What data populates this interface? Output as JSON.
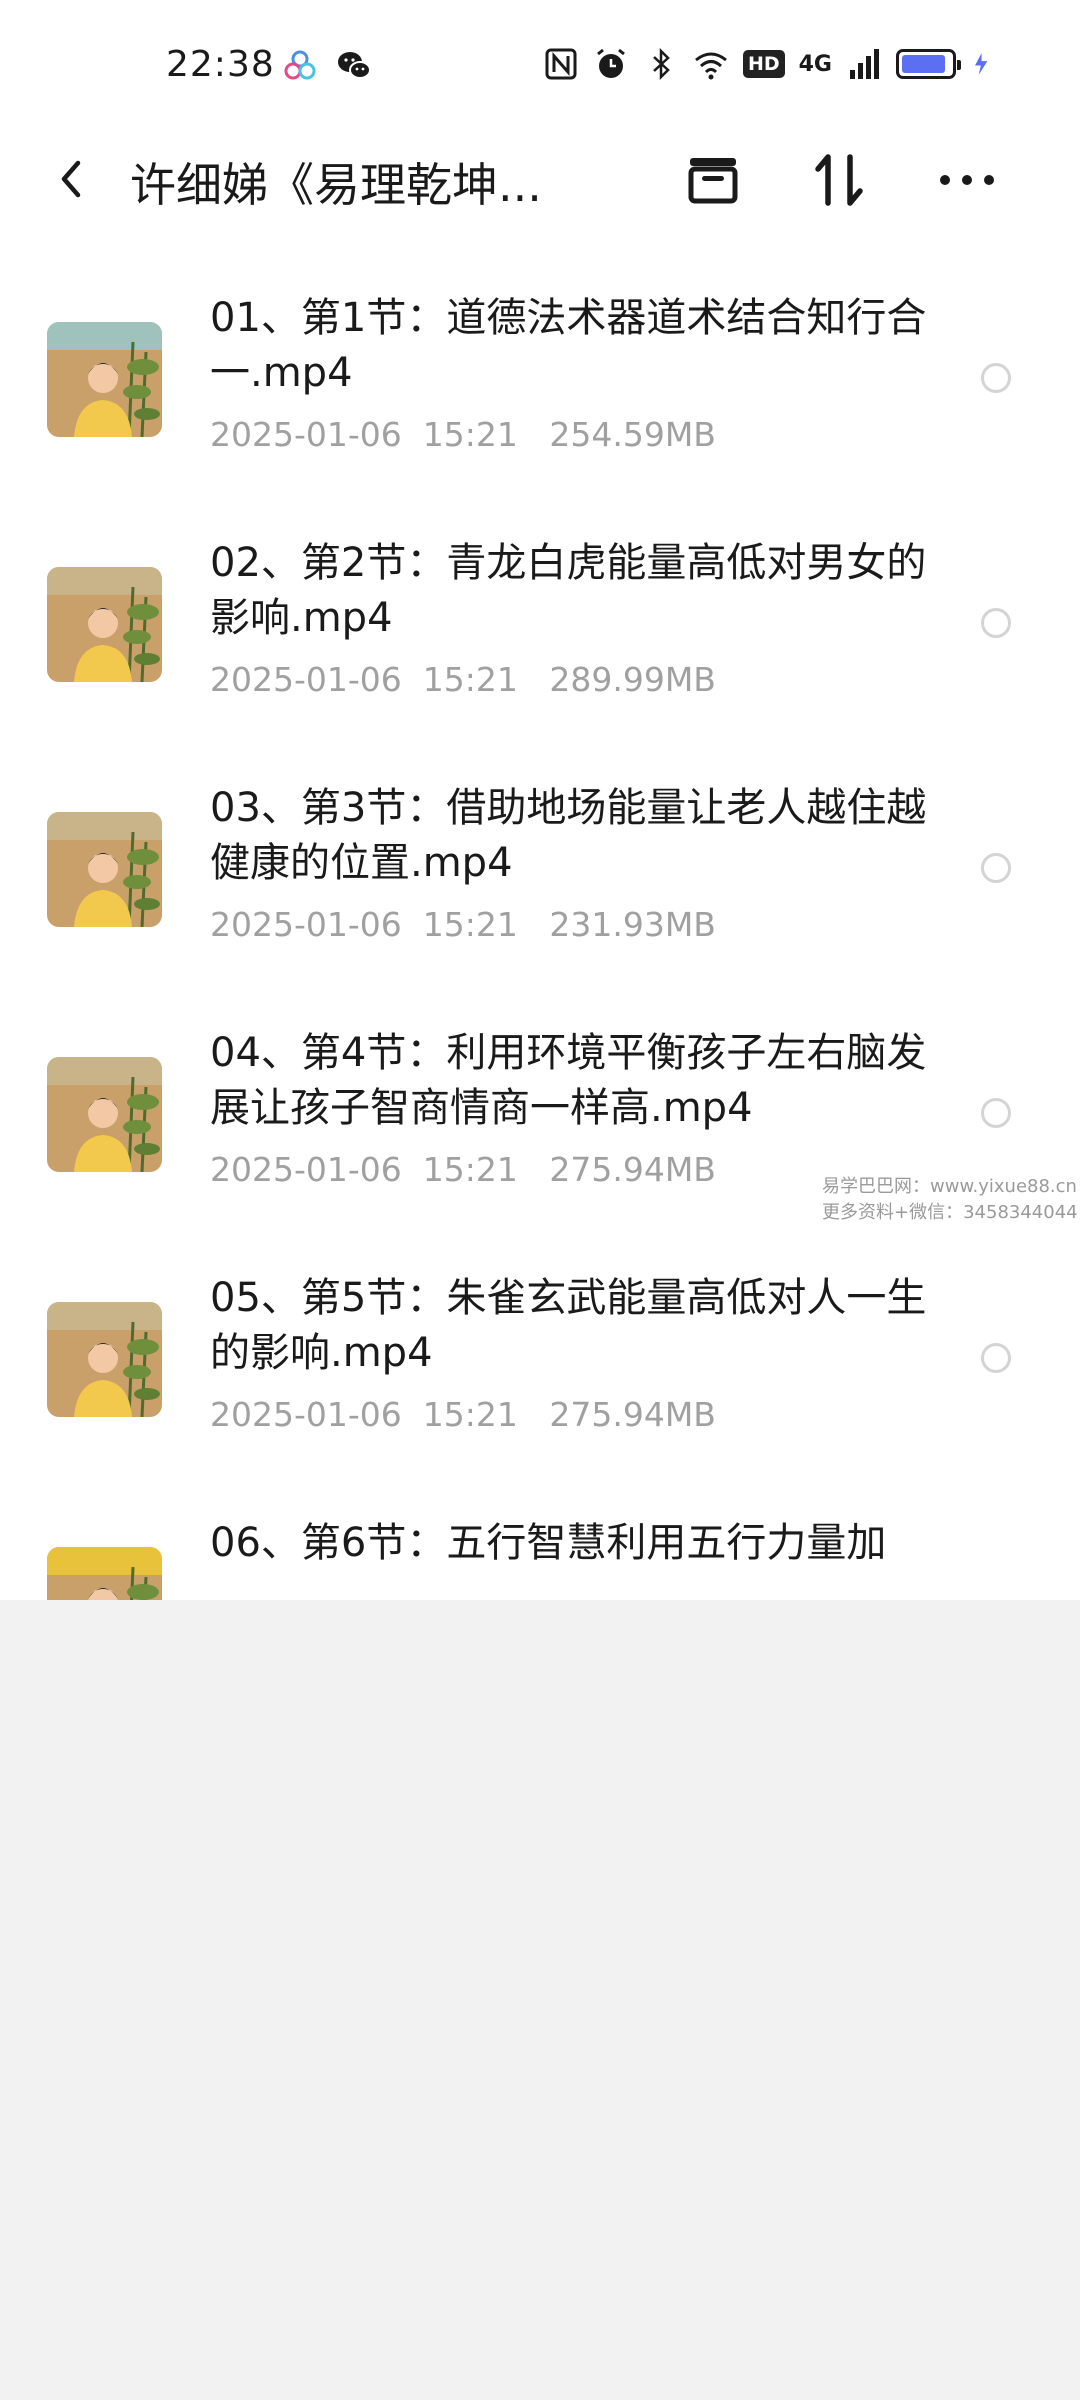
{
  "status_bar": {
    "time": "22:38",
    "network": "4G",
    "hd": "HD",
    "battery_level": 0.9,
    "battery_color": "#5c6ff2",
    "left_icons": [
      "multi-cloud-icon",
      "wechat-icon"
    ],
    "right_icons": [
      "nfc-icon",
      "alarm-icon",
      "bluetooth-icon",
      "wifi-icon",
      "hd-icon",
      "signal-icon",
      "battery-icon",
      "charging-icon"
    ]
  },
  "header": {
    "title": "许细娣《易理乾坤...",
    "back_icon": "chevron-left-icon",
    "actions": [
      "archive-icon",
      "sort-icon",
      "more-icon"
    ]
  },
  "files": [
    {
      "name": "01、第1节：道德法术器道术结合知行合一.mp4",
      "date": "2025-01-06",
      "time": "15:21",
      "size": "254.59MB",
      "thumb_top": "#9fc2bd"
    },
    {
      "name": "02、第2节：青龙白虎能量高低对男女的影响.mp4",
      "date": "2025-01-06",
      "time": "15:21",
      "size": "289.99MB",
      "thumb_top": "#c9b48a"
    },
    {
      "name": "03、第3节：借助地场能量让老人越住越健康的位置.mp4",
      "date": "2025-01-06",
      "time": "15:21",
      "size": "231.93MB",
      "thumb_top": "#c9b48a"
    },
    {
      "name": "04、第4节：利用环境平衡孩子左右脑发展让孩子智商情商一样高.mp4",
      "date": "2025-01-06",
      "time": "15:21",
      "size": "275.94MB",
      "thumb_top": "#c9b48a"
    },
    {
      "name": "05、第5节：朱雀玄武能量高低对人一生的影响.mp4",
      "date": "2025-01-06",
      "time": "15:21",
      "size": "275.94MB",
      "thumb_top": "#c9b48a"
    },
    {
      "name": "06、第6节：五行智慧利用五行力量加",
      "date": "",
      "time": "",
      "size": "",
      "thumb_top": "#e8c23a"
    }
  ],
  "watermark": {
    "line1": "易学巴巴网：www.yixue88.cn",
    "line2": "更多资料+微信：3458344044"
  },
  "colors": {
    "accent": "#5c6ff2",
    "meta_text": "#a0a0a0",
    "below_area": "#f2f2f2"
  }
}
